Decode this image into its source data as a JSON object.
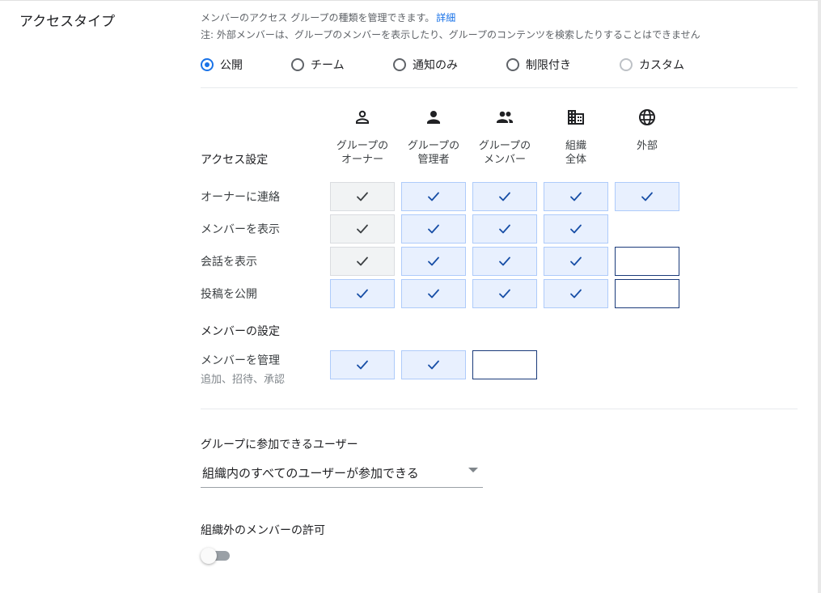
{
  "access_type": {
    "title": "アクセスタイプ",
    "description": "メンバーのアクセス グループの種類を管理できます。",
    "details_link": "詳細",
    "note": "注: 外部メンバーは、グループのメンバーを表示したり、グループのコンテンツを検索したりすることはできません",
    "options": [
      {
        "label": "公開",
        "selected": true,
        "disabled": false
      },
      {
        "label": "チーム",
        "selected": false,
        "disabled": false
      },
      {
        "label": "通知のみ",
        "selected": false,
        "disabled": false
      },
      {
        "label": "制限付き",
        "selected": false,
        "disabled": false
      },
      {
        "label": "カスタム",
        "selected": false,
        "disabled": true
      }
    ]
  },
  "matrix": {
    "access_settings_heading": "アクセス設定",
    "columns": [
      {
        "icon": "person-outline-icon",
        "line1": "グループの",
        "line2": "オーナー"
      },
      {
        "icon": "person-icon",
        "line1": "グループの",
        "line2": "管理者"
      },
      {
        "icon": "people-icon",
        "line1": "グループの",
        "line2": "メンバー"
      },
      {
        "icon": "building-icon",
        "line1": "組織",
        "line2": "全体"
      },
      {
        "icon": "globe-icon",
        "line1": "外部",
        "line2": ""
      }
    ],
    "rows": [
      {
        "label": "オーナーに連絡",
        "states": [
          "locked",
          "on",
          "on",
          "on",
          "on"
        ]
      },
      {
        "label": "メンバーを表示",
        "states": [
          "locked",
          "on",
          "on",
          "on",
          "none"
        ]
      },
      {
        "label": "会話を表示",
        "states": [
          "locked",
          "on",
          "on",
          "on",
          "off"
        ]
      },
      {
        "label": "投稿を公開",
        "states": [
          "on",
          "on",
          "on",
          "on",
          "off"
        ]
      }
    ],
    "member_settings_heading": "メンバーの設定",
    "member_rows": [
      {
        "label": "メンバーを管理",
        "sublabel": "追加、招待、承認",
        "states": [
          "on",
          "on",
          "off"
        ]
      }
    ]
  },
  "join": {
    "label": "グループに参加できるユーザー",
    "selected": "組織内のすべてのユーザーが参加できる"
  },
  "external": {
    "label": "組織外のメンバーの許可",
    "enabled": false
  },
  "colors": {
    "accent": "#1a73e8",
    "check_on_bg": "#e8f0fe",
    "locked_bg": "#f1f3f4"
  }
}
